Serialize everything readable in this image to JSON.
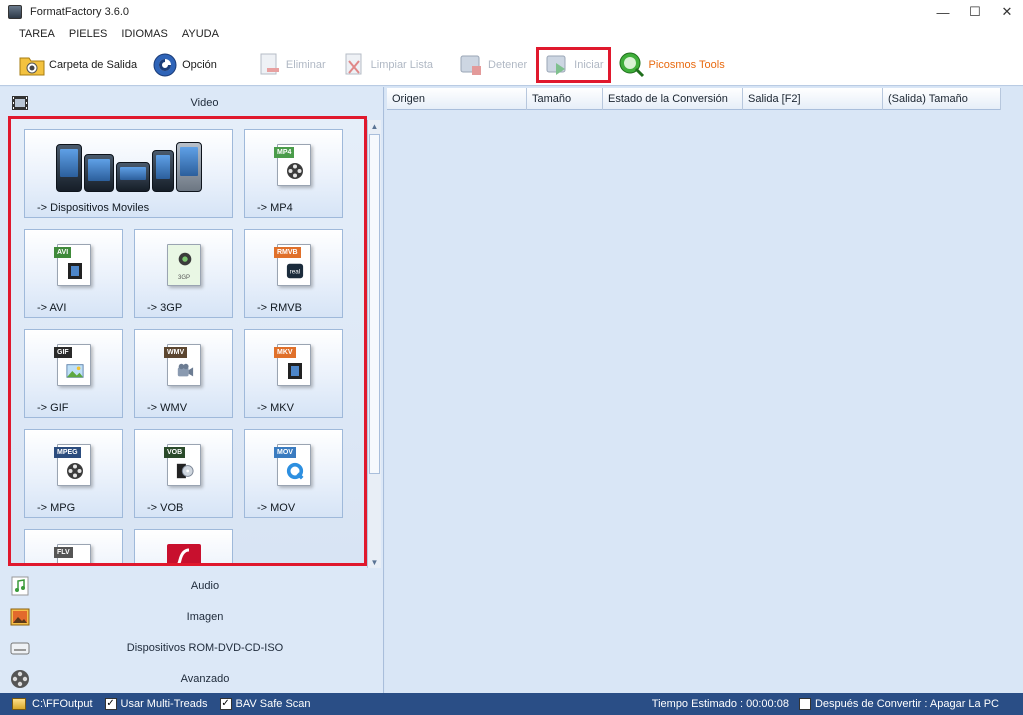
{
  "window": {
    "title": "FormatFactory 3.6.0",
    "minimize": "—",
    "maximize": "☐",
    "close": "✕"
  },
  "menu": [
    "TAREA",
    "PIELES",
    "IDIOMAS",
    "AYUDA"
  ],
  "toolbar": {
    "output_folder": "Carpeta de Salida",
    "option": "Opción",
    "delete": "Eliminar",
    "clear_list": "Limpiar Lista",
    "stop": "Detener",
    "start": "Iniciar",
    "picosmos": "Picosmos Tools"
  },
  "categories": {
    "video": "Video",
    "audio": "Audio",
    "image": "Imagen",
    "rom": "Dispositivos ROM-DVD-CD-ISO",
    "advanced": "Avanzado"
  },
  "tiles": {
    "mobile": "-> Dispositivos Moviles",
    "mp4": "-> MP4",
    "avi": "-> AVI",
    "3gp": "-> 3GP",
    "rmvb": "-> RMVB",
    "gif": "-> GIF",
    "wmv": "-> WMV",
    "mkv": "-> MKV",
    "mpg": "-> MPG",
    "vob": "-> VOB",
    "mov": "-> MOV"
  },
  "badges": {
    "mp4": "MP4",
    "avi": "AVI",
    "3gp": "3GP",
    "rmvb": "RMVB",
    "gif": "GIF",
    "wmv": "WMV",
    "mkv": "MKV",
    "mpg": "MPEG",
    "vob": "VOB",
    "mov": "MOV",
    "flv": "FLV"
  },
  "columns": [
    "Origen",
    "Tamaño",
    "Estado de la Conversión",
    "Salida [F2]",
    "(Salida) Tamaño"
  ],
  "status": {
    "output_path": "C:\\FFOutput",
    "multi_threads": "Usar Multi-Treads",
    "bav_scan": "BAV Safe Scan",
    "estimated_time": "Tiempo Estimado : 00:00:08",
    "after_convert": "Después de Convertir : Apagar La PC"
  },
  "colors": {
    "highlight": "#e0182d",
    "status_bg": "#2a4e86",
    "panel_bg": "#d9e6f6"
  }
}
